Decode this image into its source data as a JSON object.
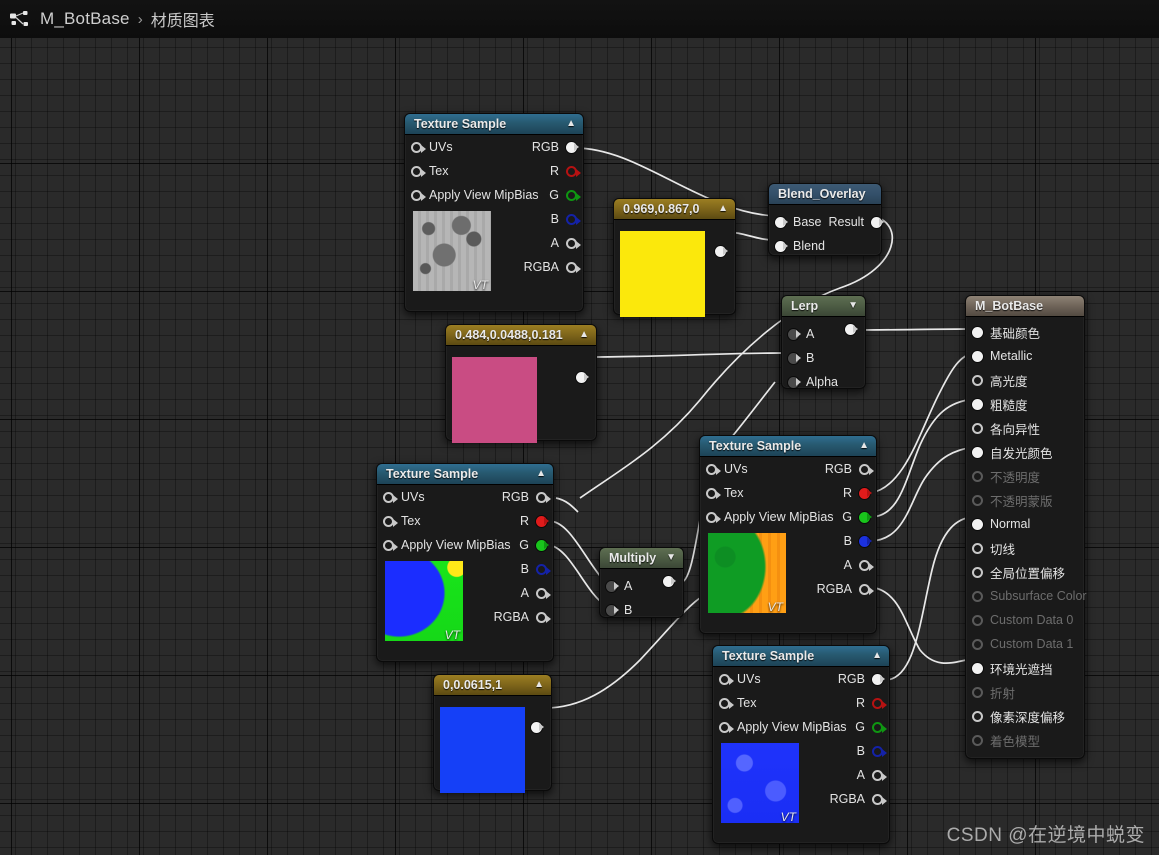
{
  "breadcrumb": {
    "icon": "material-graph-icon",
    "root": "M_BotBase",
    "separator": "›",
    "leaf": "材质图表"
  },
  "watermark": "CSDN @在逆境中蜕变",
  "colors": {
    "wire": "#e8e8e8",
    "texture_header": "#27596f",
    "math_header": "#4d5c44",
    "function_header": "#34506a",
    "constant_header": "#7e651a",
    "output_header": "#6f6459",
    "pin_red": "#e01b1b",
    "pin_green": "#19c41c",
    "pin_blue": "#1b31e0",
    "canvas": "#2a2a2a"
  },
  "nodes": {
    "tex_top": {
      "title": "Texture Sample",
      "collapse_icon": "chevron-up-icon",
      "inputs": [
        "UVs",
        "Tex",
        "Apply View MipBias"
      ],
      "outputs": [
        {
          "label": "RGB",
          "color": "gray",
          "connected": true
        },
        {
          "label": "R",
          "color": "r",
          "connected": false
        },
        {
          "label": "G",
          "color": "g",
          "connected": false
        },
        {
          "label": "B",
          "color": "b",
          "connected": false
        },
        {
          "label": "A",
          "color": "gray",
          "connected": false
        },
        {
          "label": "RGBA",
          "color": "gray",
          "connected": false
        }
      ],
      "thumbnail_label": "VT"
    },
    "tex_left": {
      "title": "Texture Sample",
      "collapse_icon": "chevron-up-icon",
      "inputs": [
        "UVs",
        "Tex",
        "Apply View MipBias"
      ],
      "outputs": [
        {
          "label": "RGB",
          "color": "gray",
          "connected": false
        },
        {
          "label": "R",
          "color": "r",
          "connected": true
        },
        {
          "label": "G",
          "color": "g",
          "connected": true
        },
        {
          "label": "B",
          "color": "b",
          "connected": false
        },
        {
          "label": "A",
          "color": "gray",
          "connected": false
        },
        {
          "label": "RGBA",
          "color": "gray",
          "connected": false
        }
      ],
      "thumbnail_label": "VT"
    },
    "tex_mid": {
      "title": "Texture Sample",
      "collapse_icon": "chevron-up-icon",
      "inputs": [
        "UVs",
        "Tex",
        "Apply View MipBias"
      ],
      "outputs": [
        {
          "label": "RGB",
          "color": "gray",
          "connected": false
        },
        {
          "label": "R",
          "color": "r",
          "connected": true
        },
        {
          "label": "G",
          "color": "g",
          "connected": true
        },
        {
          "label": "B",
          "color": "b",
          "connected": true
        },
        {
          "label": "A",
          "color": "gray",
          "connected": false
        },
        {
          "label": "RGBA",
          "color": "gray",
          "connected": false
        }
      ],
      "thumbnail_label": "VT"
    },
    "tex_bottom": {
      "title": "Texture Sample",
      "collapse_icon": "chevron-up-icon",
      "inputs": [
        "UVs",
        "Tex",
        "Apply View MipBias"
      ],
      "outputs": [
        {
          "label": "RGB",
          "color": "gray",
          "connected": true
        },
        {
          "label": "R",
          "color": "r",
          "connected": false
        },
        {
          "label": "G",
          "color": "g",
          "connected": false
        },
        {
          "label": "B",
          "color": "b",
          "connected": false
        },
        {
          "label": "A",
          "color": "gray",
          "connected": false
        },
        {
          "label": "RGBA",
          "color": "gray",
          "connected": false
        }
      ],
      "thumbnail_label": "VT"
    },
    "const_yellow": {
      "title": "0.969,0.867,0",
      "collapse_icon": "chevron-up-icon",
      "swatch_color": "#fbe80c"
    },
    "const_pink": {
      "title": "0.484,0.0488,0.181",
      "collapse_icon": "chevron-up-icon",
      "swatch_color": "#c94c83"
    },
    "const_blue": {
      "title": "0,0.0615,1",
      "collapse_icon": "chevron-up-icon",
      "swatch_color": "#1540f7"
    },
    "blend_overlay": {
      "title": "Blend_Overlay",
      "inputs": [
        "Base",
        "Blend"
      ],
      "outputs": [
        "Result"
      ]
    },
    "lerp": {
      "title": "Lerp",
      "collapse_icon": "chevron-down-icon",
      "inputs": [
        "A",
        "B",
        "Alpha"
      ]
    },
    "multiply": {
      "title": "Multiply",
      "collapse_icon": "chevron-down-icon",
      "inputs": [
        "A",
        "B"
      ]
    },
    "material_output": {
      "title": "M_BotBase",
      "pins": [
        {
          "label": "基础颜色",
          "connected": true,
          "enabled": true
        },
        {
          "label": "Metallic",
          "connected": true,
          "enabled": true
        },
        {
          "label": "高光度",
          "connected": false,
          "enabled": true
        },
        {
          "label": "粗糙度",
          "connected": true,
          "enabled": true
        },
        {
          "label": "各向异性",
          "connected": false,
          "enabled": true
        },
        {
          "label": "自发光颜色",
          "connected": true,
          "enabled": true
        },
        {
          "label": "不透明度",
          "connected": false,
          "enabled": false
        },
        {
          "label": "不透明蒙版",
          "connected": false,
          "enabled": false
        },
        {
          "label": "Normal",
          "connected": true,
          "enabled": true
        },
        {
          "label": "切线",
          "connected": false,
          "enabled": true
        },
        {
          "label": "全局位置偏移",
          "connected": false,
          "enabled": true
        },
        {
          "label": "Subsurface Color",
          "connected": false,
          "enabled": false
        },
        {
          "label": "Custom Data 0",
          "connected": false,
          "enabled": false
        },
        {
          "label": "Custom Data 1",
          "connected": false,
          "enabled": false
        },
        {
          "label": "环境光遮挡",
          "connected": true,
          "enabled": true
        },
        {
          "label": "折射",
          "connected": false,
          "enabled": false
        },
        {
          "label": "像素深度偏移",
          "connected": false,
          "enabled": true
        },
        {
          "label": "着色模型",
          "connected": false,
          "enabled": false
        }
      ]
    }
  }
}
